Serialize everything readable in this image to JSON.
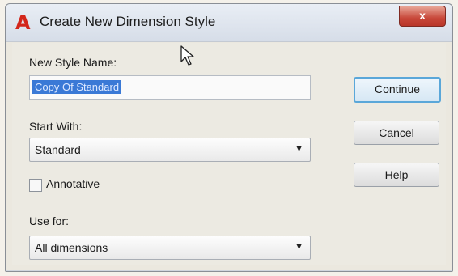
{
  "window": {
    "title": "Create New Dimension Style",
    "close_label": "x"
  },
  "icons": {
    "app": "autocad-icon",
    "close": "close-icon",
    "cursor": "mouse-pointer-icon"
  },
  "form": {
    "new_style_name_label": "New Style Name:",
    "new_style_name_value": "Copy Of Standard",
    "start_with_label": "Start With:",
    "start_with_value": "Standard",
    "annotative_label": "Annotative",
    "annotative_checked": false,
    "use_for_label": "Use for:",
    "use_for_value": "All dimensions"
  },
  "buttons": {
    "continue": "Continue",
    "cancel": "Cancel",
    "help": "Help"
  }
}
